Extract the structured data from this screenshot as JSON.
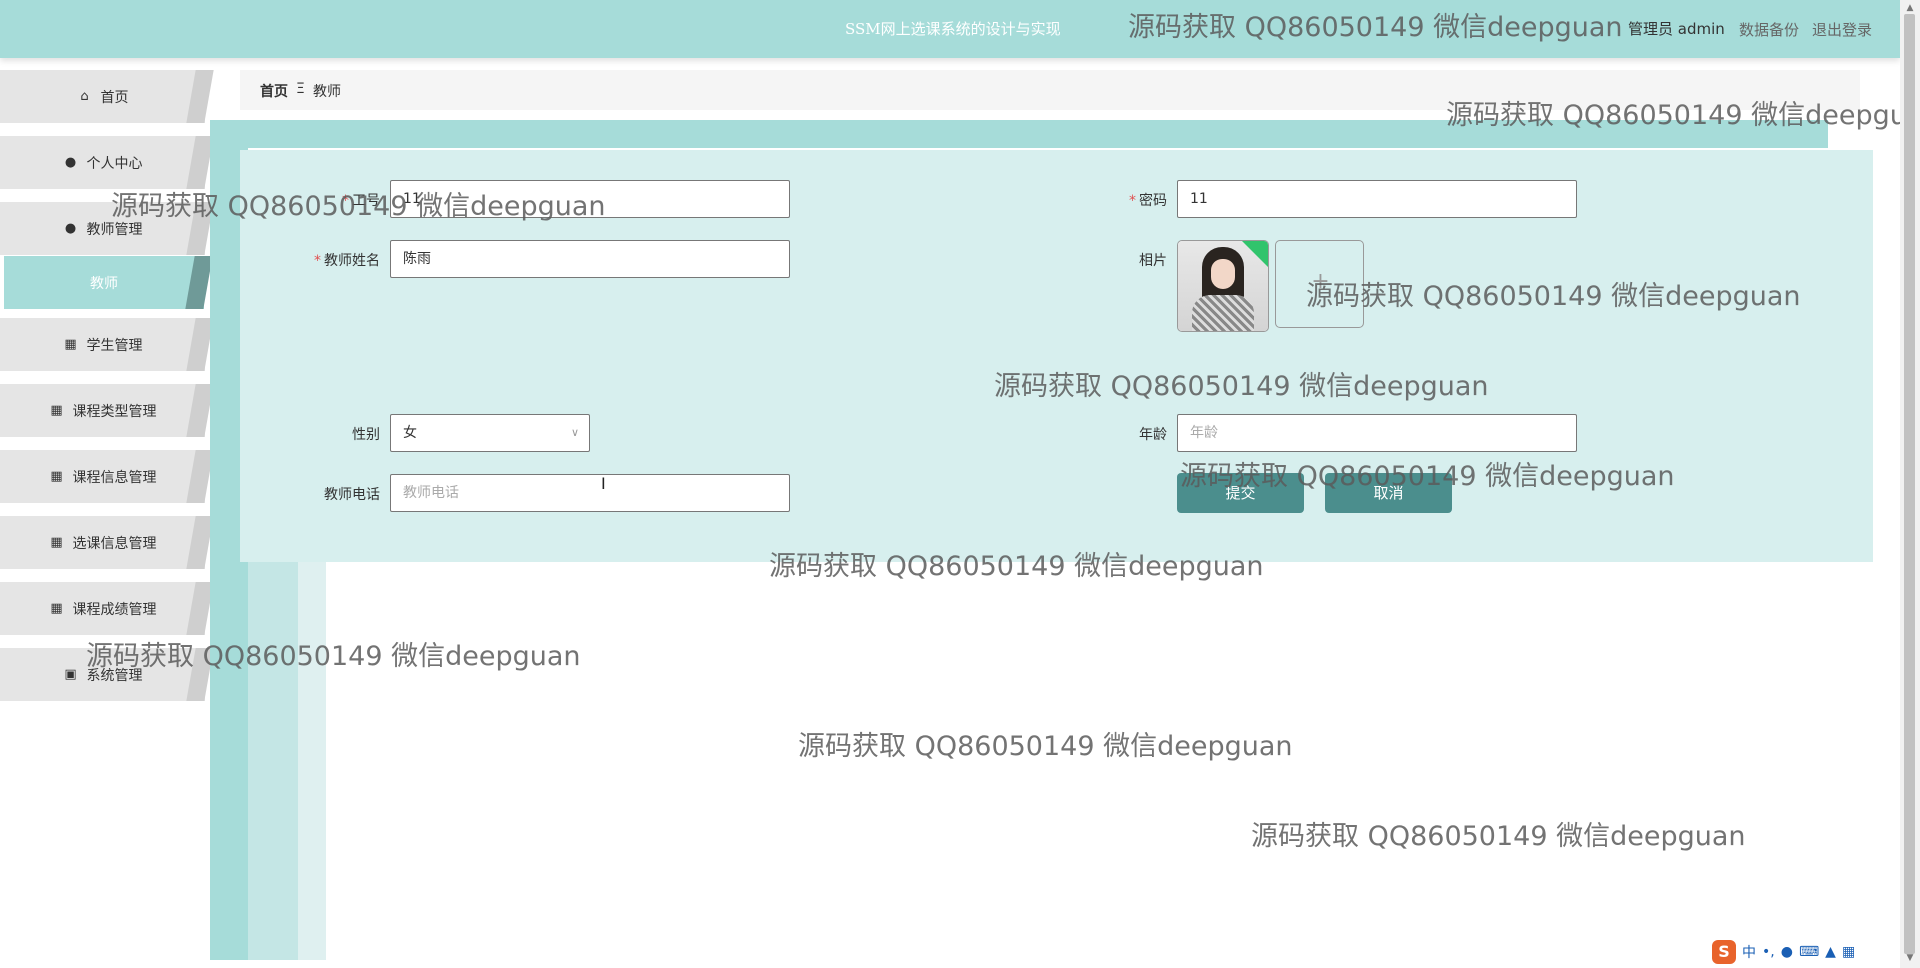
{
  "header": {
    "app_title": "SSM网上选课系统的设计与实现",
    "user_label": "管理员 admin",
    "backup_label": "数据备份",
    "logout_label": "退出登录"
  },
  "sidebar": {
    "items": [
      {
        "label": "首页",
        "icon": "home-icon"
      },
      {
        "label": "个人中心",
        "icon": "user-icon"
      },
      {
        "label": "教师管理",
        "icon": "user-icon"
      },
      {
        "label": "教师",
        "icon": ""
      },
      {
        "label": "学生管理",
        "icon": "grid-icon"
      },
      {
        "label": "课程类型管理",
        "icon": "grid-icon"
      },
      {
        "label": "课程信息管理",
        "icon": "grid-icon"
      },
      {
        "label": "选课信息管理",
        "icon": "grid-icon"
      },
      {
        "label": "课程成绩管理",
        "icon": "grid-icon"
      },
      {
        "label": "系统管理",
        "icon": "briefcase-icon"
      }
    ]
  },
  "breadcrumb": {
    "home": "首页",
    "separator": "Ξ",
    "current": "教师"
  },
  "form": {
    "account": {
      "label": "工号",
      "value": "11"
    },
    "password": {
      "label": "密码",
      "value": "11"
    },
    "name": {
      "label": "教师姓名",
      "value": "陈雨"
    },
    "photo": {
      "label": "相片"
    },
    "gender": {
      "label": "性别",
      "value": "女"
    },
    "age": {
      "label": "年龄",
      "placeholder": "年龄"
    },
    "phone": {
      "label": "教师电话",
      "placeholder": "教师电话"
    },
    "submit_label": "提交",
    "cancel_label": "取消"
  },
  "watermark_text": "源码获取 QQ86050149 微信deepguan",
  "ime": {
    "lang": "中",
    "punct": "•,"
  },
  "colors": {
    "accent": "#a6dcd9",
    "panel": "#d7efee",
    "button": "#4b8e8d",
    "required": "#e05050"
  }
}
